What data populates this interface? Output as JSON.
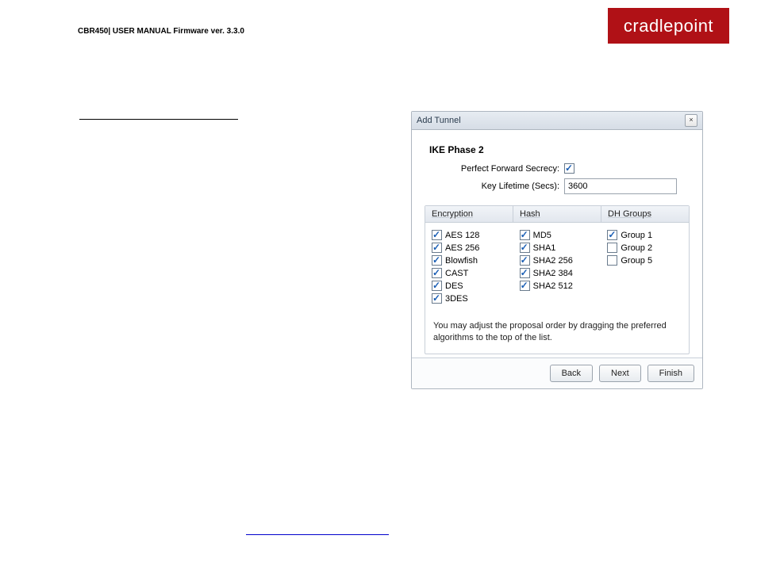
{
  "header": {
    "left_text": "CBR450| USER MANUAL Firmware ver. 3.3.0",
    "logo_text": "cradlepoint"
  },
  "dialog": {
    "title": "Add Tunnel",
    "section_title": "IKE Phase 2",
    "pfs_label": "Perfect Forward Secrecy:",
    "pfs_checked": true,
    "lifetime_label": "Key Lifetime (Secs):",
    "lifetime_value": "3600",
    "columns": {
      "encryption": {
        "header": "Encryption",
        "items": [
          {
            "label": "AES 128",
            "checked": true
          },
          {
            "label": "AES 256",
            "checked": true
          },
          {
            "label": "Blowfish",
            "checked": true
          },
          {
            "label": "CAST",
            "checked": true
          },
          {
            "label": "DES",
            "checked": true
          },
          {
            "label": "3DES",
            "checked": true
          }
        ]
      },
      "hash": {
        "header": "Hash",
        "items": [
          {
            "label": "MD5",
            "checked": true
          },
          {
            "label": "SHA1",
            "checked": true
          },
          {
            "label": "SHA2 256",
            "checked": true
          },
          {
            "label": "SHA2 384",
            "checked": true
          },
          {
            "label": "SHA2 512",
            "checked": true
          }
        ]
      },
      "dh": {
        "header": "DH Groups",
        "items": [
          {
            "label": "Group 1",
            "checked": true
          },
          {
            "label": "Group 2",
            "checked": false
          },
          {
            "label": "Group 5",
            "checked": false
          }
        ]
      }
    },
    "hint": "You may adjust the proposal order by dragging the preferred algorithms to the top of the list.",
    "buttons": {
      "back": "Back",
      "next": "Next",
      "finish": "Finish"
    }
  }
}
